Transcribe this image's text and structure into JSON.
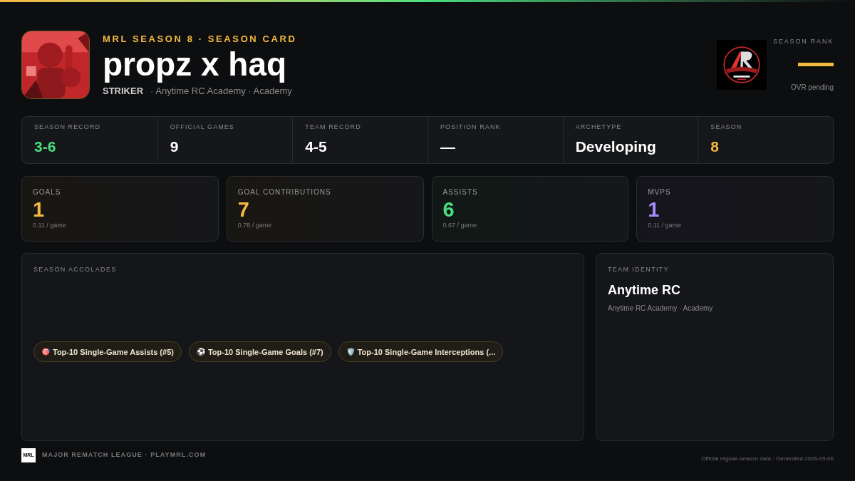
{
  "header": {
    "eyebrow": "MRL SEASON 8 · SEASON CARD",
    "player_name": "propz x haq",
    "position": "STRIKER",
    "team_line": "· Anytime RC Academy · Academy"
  },
  "rank": {
    "label": "SEASON RANK",
    "note": "OVR pending"
  },
  "record_strip": [
    {
      "label": "SEASON RECORD",
      "value": "3-6",
      "color": "#4ade80"
    },
    {
      "label": "OFFICIAL GAMES",
      "value": "9",
      "color": "#ffffff"
    },
    {
      "label": "TEAM RECORD",
      "value": "4-5",
      "color": "#ffffff"
    },
    {
      "label": "POSITION RANK",
      "value": "—",
      "color": "#ffffff"
    },
    {
      "label": "ARCHETYPE",
      "value": "Developing",
      "color": "#ffffff"
    },
    {
      "label": "SEASON",
      "value": "8",
      "color": "#f5b942"
    }
  ],
  "stat_cards": [
    {
      "label": "GOALS",
      "value": "1",
      "per_game": "0.11 / game",
      "color": "#f5b942"
    },
    {
      "label": "GOAL CONTRIBUTIONS",
      "value": "7",
      "per_game": "0.78 / game",
      "color": "#f5b942"
    },
    {
      "label": "ASSISTS",
      "value": "6",
      "per_game": "0.67 / game",
      "color": "#4ade80"
    },
    {
      "label": "MVPS",
      "value": "1",
      "per_game": "0.11 / game",
      "color": "#a78bfa"
    }
  ],
  "accolades": {
    "title": "SEASON ACCOLADES",
    "items": [
      {
        "icon": "🎯",
        "text": "Top-10 Single-Game Assists (#5)"
      },
      {
        "icon": "⚽",
        "text": "Top-10 Single-Game Goals (#7)"
      },
      {
        "icon": "🛡️",
        "text": "Top-10 Single-Game Interceptions (..."
      }
    ]
  },
  "team_identity": {
    "title": "TEAM IDENTITY",
    "team_name": "Anytime RC",
    "subtitle": "Anytime RC Academy · Academy"
  },
  "footer": {
    "logo_text": "MRL",
    "league": "MAJOR REMATCH LEAGUE · PLAYMRL.COM",
    "note": "Official regular-season data · Generated 2026-09-06"
  }
}
